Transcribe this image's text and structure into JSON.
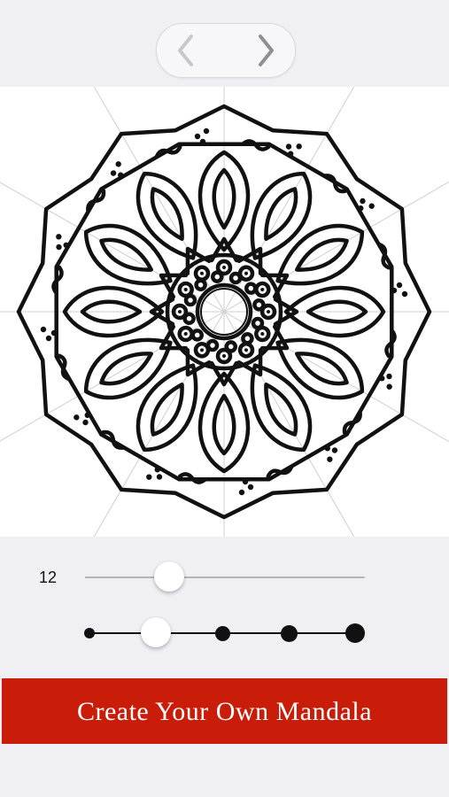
{
  "nav": {
    "prev_icon": "chevron-left-icon",
    "next_icon": "chevron-right-icon",
    "prev_color": "#c7c7cc",
    "next_color": "#8e8e93"
  },
  "canvas": {
    "background": "#ffffff",
    "guide_color": "#cfcfcf",
    "ink_color": "#111111"
  },
  "symmetry": {
    "value": "12",
    "level": 0.3
  },
  "stroke_width": {
    "options": 5,
    "selected_index": 1
  },
  "cta": {
    "label": "Create Your Own Mandala",
    "color": "#c91d0a"
  }
}
